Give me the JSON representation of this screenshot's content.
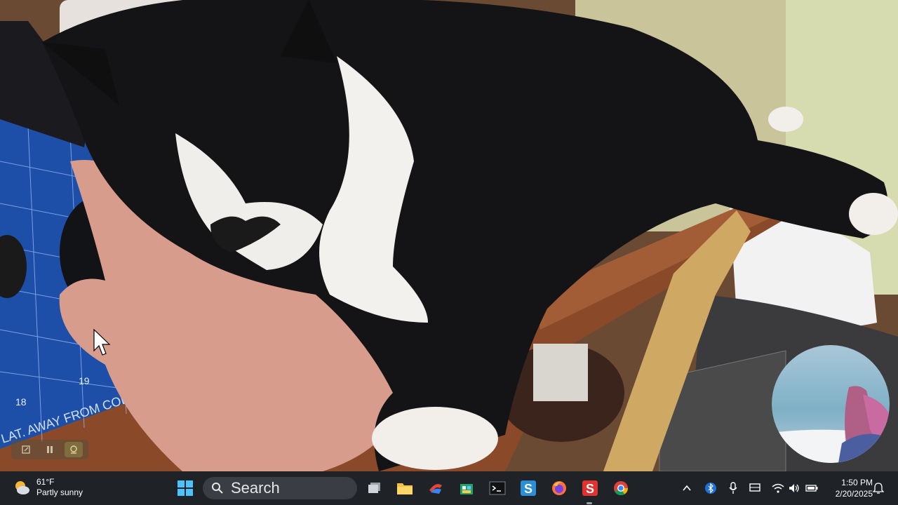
{
  "photo": {
    "description_icon": "cat-on-hand-photo-icon",
    "mat_text": "LAT. AWAY FROM COLD",
    "ruler_numbers": [
      "18",
      "19"
    ]
  },
  "recording_toolbar": {
    "buttons": [
      {
        "icon": "edit-icon"
      },
      {
        "icon": "pause-icon"
      },
      {
        "icon": "webcam-icon"
      }
    ]
  },
  "taskbar": {
    "weather": {
      "temp": "61°F",
      "condition": "Partly sunny",
      "icon": "partly-sunny-icon"
    },
    "start_icon": "windows-start-icon",
    "search": {
      "label": "Search",
      "icon": "search-icon"
    },
    "apps": [
      {
        "name": "task-view",
        "icon": "task-view-icon"
      },
      {
        "name": "file-explorer",
        "icon": "folder-icon"
      },
      {
        "name": "snip",
        "icon": "snip-icon"
      },
      {
        "name": "store",
        "icon": "store-icon"
      },
      {
        "name": "terminal",
        "icon": "terminal-icon"
      },
      {
        "name": "app-s-blue",
        "icon": "s-blue-icon"
      },
      {
        "name": "firefox",
        "icon": "firefox-icon"
      },
      {
        "name": "app-s-red",
        "icon": "s-red-icon"
      },
      {
        "name": "chrome",
        "icon": "chrome-icon"
      }
    ],
    "tray": [
      "chevron-up-icon",
      "bluetooth-icon",
      "microphone-icon",
      "display-icon",
      "wifi-icon",
      "volume-icon",
      "battery-icon"
    ],
    "clock": {
      "time": "1:50 PM",
      "date": "2/20/2025"
    },
    "notification_icon": "notification-bell-icon",
    "colors": {
      "taskbar_bg": "#1f2227",
      "search_bg": "#3a3d43"
    }
  }
}
